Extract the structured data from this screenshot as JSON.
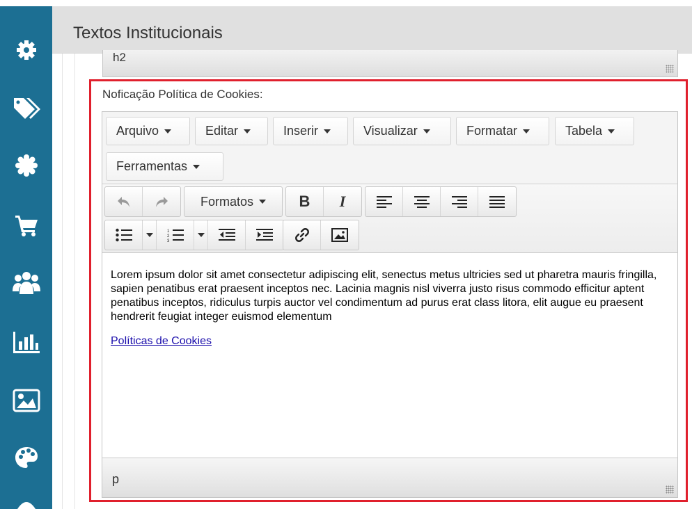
{
  "header": {
    "title": "Textos Institucionais"
  },
  "sidebar": {
    "items": [
      {
        "icon": "gear-icon"
      },
      {
        "icon": "tags-icon"
      },
      {
        "icon": "badge-icon"
      },
      {
        "icon": "cart-icon"
      },
      {
        "icon": "users-icon"
      },
      {
        "icon": "bar-chart-icon"
      },
      {
        "icon": "image-icon"
      },
      {
        "icon": "palette-icon"
      }
    ]
  },
  "previous_field": {
    "path": "h2"
  },
  "field": {
    "label": "Noficação Política de Cookies:",
    "menubar": [
      "Arquivo",
      "Editar",
      "Inserir",
      "Visualizar",
      "Formatar",
      "Tabela",
      "Ferramentas"
    ],
    "toolbar": {
      "formats_label": "Formatos",
      "bold_label": "B",
      "italic_label": "I"
    },
    "content": {
      "paragraph": "Lorem ipsum dolor sit amet consectetur adipiscing elit, senectus metus ultricies sed ut pharetra mauris fringilla, sapien penatibus erat praesent inceptos nec. Lacinia magnis nisl viverra justo risus commodo efficitur aptent penatibus inceptos, ridiculus turpis auctor vel condimentum ad purus erat class litora, elit augue eu praesent hendrerit feugiat integer euismod elementum",
      "link": "Políticas de Cookies"
    },
    "path": "p"
  },
  "colors": {
    "sidebar": "#1c6f93",
    "highlight": "#e0202d",
    "link": "#1a0dab"
  }
}
